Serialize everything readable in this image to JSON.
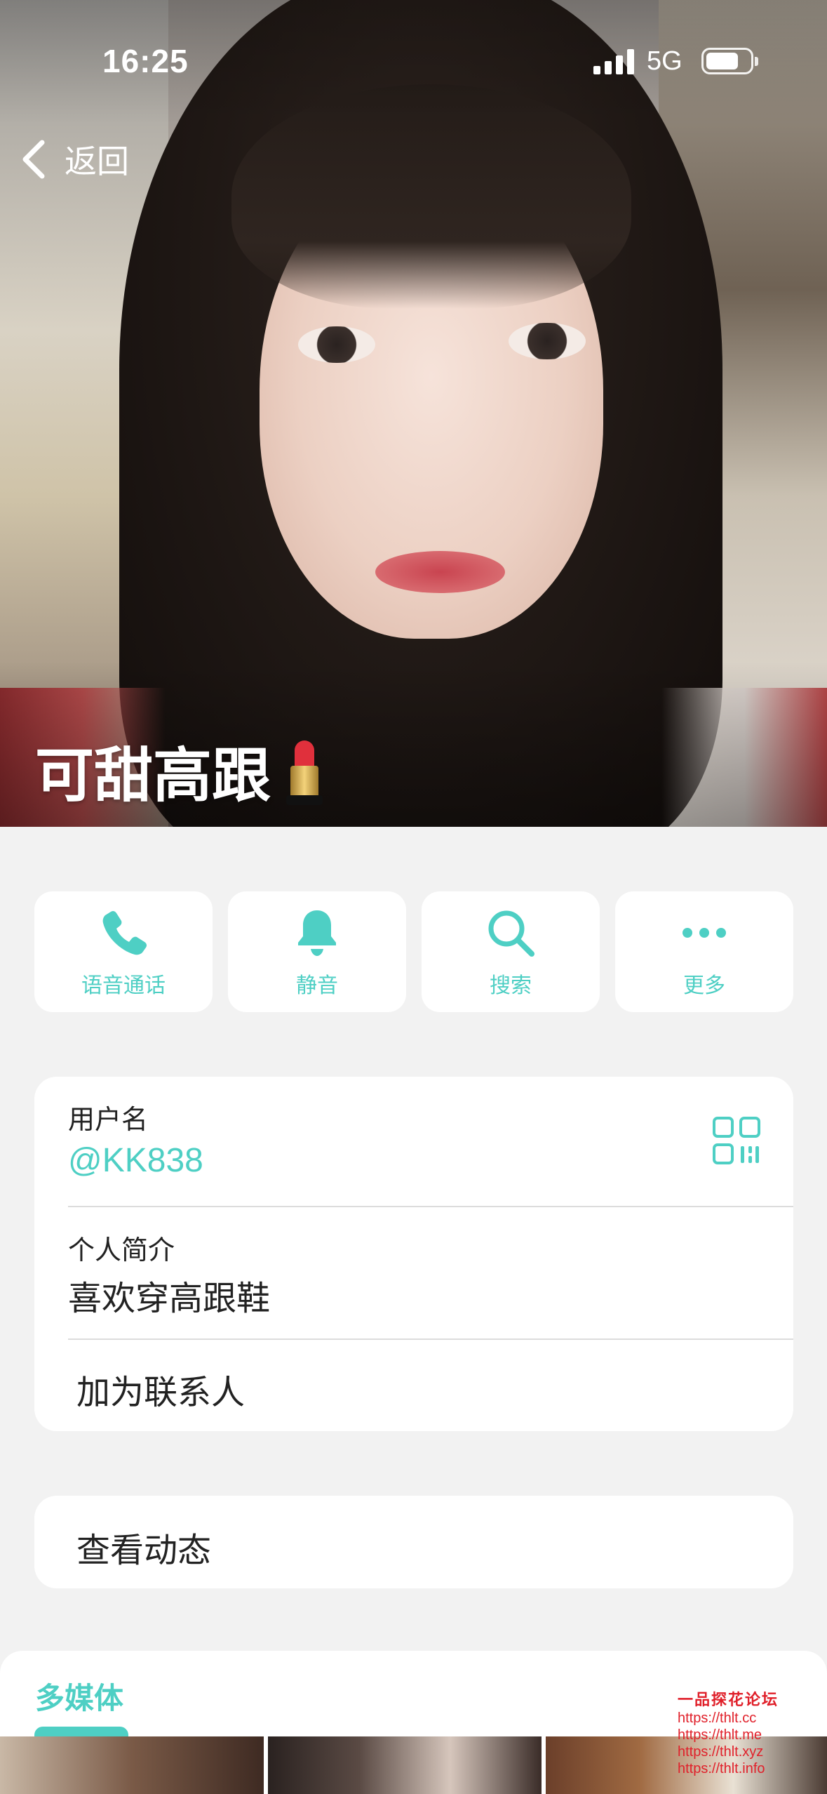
{
  "status_bar": {
    "time": "16:25",
    "network": "5G",
    "battery_level": 0.75
  },
  "nav": {
    "back_label": "返回"
  },
  "profile": {
    "name": "可甜高跟",
    "name_emoji": "lipstick"
  },
  "actions": [
    {
      "label": "语音通话",
      "icon": "phone-icon"
    },
    {
      "label": "静音",
      "icon": "bell-icon"
    },
    {
      "label": "搜索",
      "icon": "search-icon"
    },
    {
      "label": "更多",
      "icon": "more-icon"
    }
  ],
  "info": {
    "username_label": "用户名",
    "username": "@KK838",
    "bio_label": "个人简介",
    "bio": "喜欢穿高跟鞋",
    "add_contact": "加为联系人"
  },
  "moments": {
    "label": "查看动态"
  },
  "media": {
    "title": "多媒体"
  },
  "watermark": {
    "title": "一品探花论坛",
    "lines": [
      "https://thlt.cc",
      "https://thlt.me",
      "https://thlt.xyz",
      "https://thlt.info"
    ]
  },
  "colors": {
    "accent": "#4ecfc4",
    "background": "#f2f2f2",
    "card": "#ffffff",
    "text": "#222222"
  }
}
